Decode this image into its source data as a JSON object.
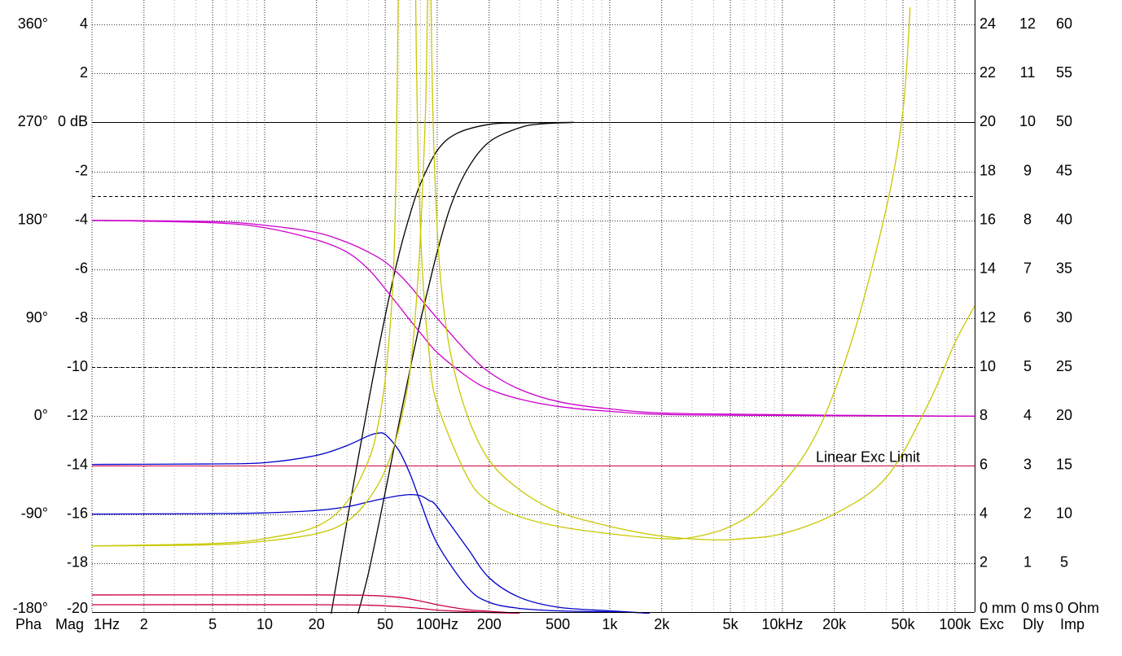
{
  "chart_data": {
    "type": "line",
    "x_scale": "log",
    "xlim": [
      1,
      130000
    ],
    "ylim": [
      -20,
      5
    ],
    "grid": true,
    "colors": {
      "pha": "#cc00cc",
      "mag": "#000000",
      "exc": "#cc0044",
      "dly": "#0000cc",
      "imp": "#c8c800",
      "minor_grid": "#808080"
    },
    "x_tick_labels": [
      {
        "x": 1,
        "label": "1Hz"
      },
      {
        "x": 2,
        "label": "2"
      },
      {
        "x": 5,
        "label": "5"
      },
      {
        "x": 10,
        "label": "10"
      },
      {
        "x": 20,
        "label": "20"
      },
      {
        "x": 50,
        "label": "50"
      },
      {
        "x": 100,
        "label": "100Hz"
      },
      {
        "x": 200,
        "label": "200"
      },
      {
        "x": 500,
        "label": "500"
      },
      {
        "x": 1000,
        "label": "1k"
      },
      {
        "x": 2000,
        "label": "2k"
      },
      {
        "x": 5000,
        "label": "5k"
      },
      {
        "x": 10000,
        "label": "10kHz"
      },
      {
        "x": 20000,
        "label": "20k"
      },
      {
        "x": 50000,
        "label": "50k"
      },
      {
        "x": 100000,
        "label": "100k"
      }
    ],
    "y_axes": {
      "phase": [
        {
          "y": 4,
          "label": "360°"
        },
        {
          "y": 0,
          "label": "270°"
        },
        {
          "y": -4,
          "label": "180°"
        },
        {
          "y": -8,
          "label": "90°"
        },
        {
          "y": -12,
          "label": "0°"
        },
        {
          "y": -16,
          "label": "-90°"
        },
        {
          "y": -20,
          "label": "-180°"
        }
      ],
      "magnitude": [
        {
          "y": 4,
          "label": "4"
        },
        {
          "y": 2,
          "label": "2"
        },
        {
          "y": 0,
          "label": "0 dB"
        },
        {
          "y": -2,
          "label": "-2"
        },
        {
          "y": -4,
          "label": "-4"
        },
        {
          "y": -6,
          "label": "-6"
        },
        {
          "y": -8,
          "label": "-8"
        },
        {
          "y": -10,
          "label": "-10"
        },
        {
          "y": -12,
          "label": "-12"
        },
        {
          "y": -14,
          "label": "-14"
        },
        {
          "y": -16,
          "label": "-16"
        },
        {
          "y": -18,
          "label": "-18"
        },
        {
          "y": -20,
          "label": "-20"
        }
      ],
      "excursion": [
        {
          "y": 4,
          "label": "24"
        },
        {
          "y": 2,
          "label": "22"
        },
        {
          "y": 0,
          "label": "20"
        },
        {
          "y": -2,
          "label": "18"
        },
        {
          "y": -4,
          "label": "16"
        },
        {
          "y": -6,
          "label": "14"
        },
        {
          "y": -8,
          "label": "12"
        },
        {
          "y": -10,
          "label": "10"
        },
        {
          "y": -12,
          "label": "8"
        },
        {
          "y": -14,
          "label": "6"
        },
        {
          "y": -16,
          "label": "4"
        },
        {
          "y": -18,
          "label": "2"
        },
        {
          "y": -20,
          "label": "0 mm"
        }
      ],
      "delay": [
        {
          "y": 4,
          "label": "12"
        },
        {
          "y": 2,
          "label": "11"
        },
        {
          "y": 0,
          "label": "10"
        },
        {
          "y": -2,
          "label": "9"
        },
        {
          "y": -4,
          "label": "8"
        },
        {
          "y": -6,
          "label": "7"
        },
        {
          "y": -8,
          "label": "6"
        },
        {
          "y": -10,
          "label": "5"
        },
        {
          "y": -12,
          "label": "4"
        },
        {
          "y": -14,
          "label": "3"
        },
        {
          "y": -16,
          "label": "2"
        },
        {
          "y": -18,
          "label": "1"
        },
        {
          "y": -20,
          "label": "0 ms"
        }
      ],
      "impedance": [
        {
          "y": 4,
          "label": "60"
        },
        {
          "y": 2,
          "label": "55"
        },
        {
          "y": 0,
          "label": "50"
        },
        {
          "y": -2,
          "label": "45"
        },
        {
          "y": -4,
          "label": "40"
        },
        {
          "y": -6,
          "label": "35"
        },
        {
          "y": -8,
          "label": "30"
        },
        {
          "y": -10,
          "label": "25"
        },
        {
          "y": -12,
          "label": "20"
        },
        {
          "y": -14,
          "label": "15"
        },
        {
          "y": -16,
          "label": "10"
        },
        {
          "y": -18,
          "label": "5"
        },
        {
          "y": -20,
          "label": "0 Ohm"
        }
      ]
    },
    "dashed_lines": [
      -3,
      -10
    ],
    "annotations": [
      {
        "text": "Linear Exc Limit",
        "x": 12000,
        "y": -14,
        "color": "#cc0044"
      }
    ],
    "legend": {
      "position": "bottom",
      "items": [
        {
          "key": "pha",
          "label": "Pha"
        },
        {
          "key": "mag",
          "label": "Mag"
        },
        {
          "key": "exc",
          "label": "Exc"
        },
        {
          "key": "dly",
          "label": "Dly"
        },
        {
          "key": "imp",
          "label": "Imp"
        }
      ]
    },
    "series": [
      {
        "kind": "mag",
        "points": [
          [
            24,
            -20.3
          ],
          [
            30,
            -16.3
          ],
          [
            40,
            -11.4
          ],
          [
            50,
            -7.9
          ],
          [
            60,
            -5.4
          ],
          [
            70,
            -3.7
          ],
          [
            80,
            -2.5
          ],
          [
            100,
            -1.15
          ],
          [
            130,
            -0.45
          ],
          [
            200,
            -0.08
          ],
          [
            300,
            -0.02
          ],
          [
            620,
            0
          ]
        ]
      },
      {
        "kind": "mag",
        "points": [
          [
            34,
            -20.3
          ],
          [
            40,
            -18.4
          ],
          [
            50,
            -15.1
          ],
          [
            60,
            -12.3
          ],
          [
            70,
            -10
          ],
          [
            80,
            -8.1
          ],
          [
            90,
            -6.6
          ],
          [
            100,
            -5.3
          ],
          [
            120,
            -3.4
          ],
          [
            150,
            -1.9
          ],
          [
            200,
            -0.8
          ],
          [
            300,
            -0.22
          ],
          [
            400,
            -0.06
          ],
          [
            620,
            0
          ]
        ]
      },
      {
        "kind": "pha",
        "points": [
          [
            1,
            -4
          ],
          [
            5,
            -4.1
          ],
          [
            10,
            -4.3
          ],
          [
            20,
            -4.8
          ],
          [
            30,
            -5.3
          ],
          [
            40,
            -6
          ],
          [
            50,
            -6.8
          ],
          [
            60,
            -7.5
          ],
          [
            70,
            -8.1
          ],
          [
            80,
            -8.6
          ],
          [
            100,
            -9.4
          ],
          [
            150,
            -10.4
          ],
          [
            200,
            -10.9
          ],
          [
            300,
            -11.3
          ],
          [
            500,
            -11.6
          ],
          [
            1000,
            -11.8
          ],
          [
            3000,
            -11.95
          ],
          [
            130000,
            -12
          ]
        ]
      },
      {
        "kind": "pha",
        "points": [
          [
            1,
            -4
          ],
          [
            5,
            -4.05
          ],
          [
            10,
            -4.2
          ],
          [
            20,
            -4.5
          ],
          [
            30,
            -4.9
          ],
          [
            40,
            -5.3
          ],
          [
            50,
            -5.7
          ],
          [
            60,
            -6.2
          ],
          [
            70,
            -6.7
          ],
          [
            80,
            -7.2
          ],
          [
            100,
            -8
          ],
          [
            150,
            -9.4
          ],
          [
            200,
            -10.2
          ],
          [
            300,
            -10.9
          ],
          [
            500,
            -11.4
          ],
          [
            1000,
            -11.7
          ],
          [
            3000,
            -11.9
          ],
          [
            130000,
            -12
          ]
        ]
      },
      {
        "kind": "dly",
        "points": [
          [
            1,
            -13.97
          ],
          [
            5,
            -13.95
          ],
          [
            10,
            -13.9
          ],
          [
            20,
            -13.6
          ],
          [
            30,
            -13.2
          ],
          [
            40,
            -12.8
          ],
          [
            45,
            -12.7
          ],
          [
            50,
            -12.75
          ],
          [
            60,
            -13.4
          ],
          [
            70,
            -14.4
          ],
          [
            80,
            -15.5
          ],
          [
            100,
            -17.2
          ],
          [
            150,
            -19
          ],
          [
            200,
            -19.6
          ],
          [
            300,
            -19.85
          ],
          [
            500,
            -19.95
          ],
          [
            1200,
            -20
          ],
          [
            1700,
            -20.05
          ]
        ]
      },
      {
        "kind": "dly",
        "points": [
          [
            1,
            -16
          ],
          [
            5,
            -15.98
          ],
          [
            10,
            -15.95
          ],
          [
            20,
            -15.85
          ],
          [
            30,
            -15.7
          ],
          [
            40,
            -15.5
          ],
          [
            50,
            -15.35
          ],
          [
            60,
            -15.25
          ],
          [
            70,
            -15.2
          ],
          [
            80,
            -15.25
          ],
          [
            90,
            -15.45
          ],
          [
            100,
            -15.7
          ],
          [
            150,
            -17.4
          ],
          [
            200,
            -18.6
          ],
          [
            300,
            -19.4
          ],
          [
            500,
            -19.8
          ],
          [
            1000,
            -19.95
          ],
          [
            1700,
            -20.05
          ]
        ]
      },
      {
        "kind": "exc",
        "points": [
          [
            1,
            -19.3
          ],
          [
            20,
            -19.3
          ],
          [
            40,
            -19.32
          ],
          [
            60,
            -19.4
          ],
          [
            80,
            -19.55
          ],
          [
            100,
            -19.7
          ],
          [
            150,
            -19.9
          ],
          [
            200,
            -19.97
          ],
          [
            300,
            -20.05
          ]
        ]
      },
      {
        "kind": "exc",
        "points": [
          [
            1,
            -19.7
          ],
          [
            20,
            -19.7
          ],
          [
            40,
            -19.72
          ],
          [
            60,
            -19.78
          ],
          [
            80,
            -19.85
          ],
          [
            100,
            -19.92
          ],
          [
            150,
            -19.98
          ],
          [
            200,
            -20.02
          ],
          [
            300,
            -20.05
          ]
        ]
      },
      {
        "kind": "imp",
        "points": [
          [
            1,
            -17.3
          ],
          [
            5,
            -17.2
          ],
          [
            10,
            -17
          ],
          [
            20,
            -16.5
          ],
          [
            30,
            -15.5
          ],
          [
            40,
            -13.8
          ],
          [
            45,
            -12.5
          ],
          [
            50,
            -10.5
          ],
          [
            55,
            -7
          ],
          [
            57,
            -4
          ],
          [
            58,
            -1
          ],
          [
            59,
            3
          ],
          [
            59.5,
            5.2
          ]
        ]
      },
      {
        "kind": "imp",
        "points": [
          [
            75,
            5.2
          ],
          [
            76,
            2
          ],
          [
            78,
            -2
          ],
          [
            82,
            -6
          ],
          [
            90,
            -9.5
          ],
          [
            100,
            -11.5
          ],
          [
            150,
            -14.5
          ],
          [
            200,
            -15.5
          ],
          [
            300,
            -16.1
          ],
          [
            500,
            -16.5
          ],
          [
            1000,
            -16.8
          ],
          [
            2000,
            -17
          ],
          [
            3000,
            -16.95
          ],
          [
            5000,
            -16.5
          ],
          [
            8000,
            -15.5
          ],
          [
            15000,
            -13
          ],
          [
            25000,
            -9
          ],
          [
            40000,
            -3.5
          ],
          [
            50000,
            0.5
          ],
          [
            55000,
            4.7
          ]
        ]
      },
      {
        "kind": "imp",
        "points": [
          [
            1,
            -17.3
          ],
          [
            5,
            -17.25
          ],
          [
            10,
            -17.1
          ],
          [
            20,
            -16.8
          ],
          [
            30,
            -16.3
          ],
          [
            40,
            -15.4
          ],
          [
            50,
            -14.2
          ],
          [
            60,
            -12.5
          ],
          [
            70,
            -10
          ],
          [
            78,
            -6
          ],
          [
            83,
            -2
          ],
          [
            86,
            1
          ],
          [
            88,
            5.2
          ]
        ]
      },
      {
        "kind": "imp",
        "points": [
          [
            92,
            5.2
          ],
          [
            94,
            1
          ],
          [
            98,
            -3
          ],
          [
            105,
            -6.5
          ],
          [
            120,
            -9.5
          ],
          [
            150,
            -12
          ],
          [
            200,
            -13.8
          ],
          [
            300,
            -15
          ],
          [
            500,
            -15.9
          ],
          [
            1000,
            -16.5
          ],
          [
            2000,
            -16.9
          ],
          [
            4000,
            -17.05
          ],
          [
            6000,
            -17
          ],
          [
            10000,
            -16.8
          ],
          [
            20000,
            -16
          ],
          [
            40000,
            -14.5
          ],
          [
            70000,
            -11.5
          ],
          [
            100000,
            -9
          ],
          [
            130000,
            -7.5
          ]
        ]
      }
    ]
  }
}
